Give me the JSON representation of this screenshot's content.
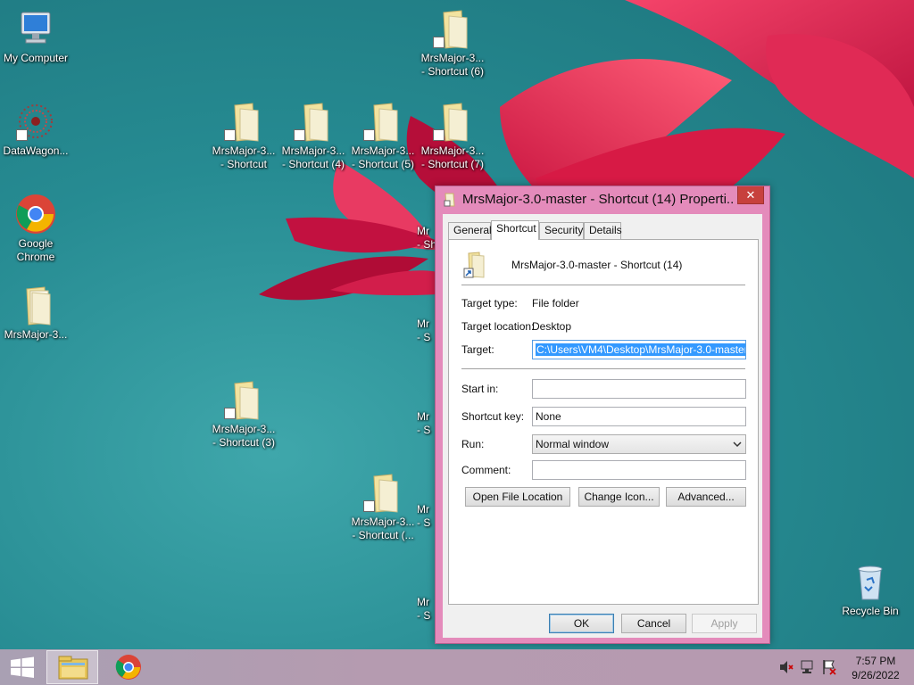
{
  "desktop_icons": [
    {
      "id": "my-computer",
      "label": "My Computer"
    },
    {
      "id": "datawagon",
      "label": "DataWagon..."
    },
    {
      "id": "google-chrome",
      "label": "Google\nChrome"
    },
    {
      "id": "mrsmajor",
      "label": "MrsMajor-3..."
    },
    {
      "id": "shortcut-6",
      "label": "MrsMajor-3...\n- Shortcut (6)"
    },
    {
      "id": "shortcut",
      "label": "MrsMajor-3...\n- Shortcut"
    },
    {
      "id": "shortcut-4",
      "label": "MrsMajor-3...\n- Shortcut (4)"
    },
    {
      "id": "shortcut-5",
      "label": "MrsMajor-3...\n- Shortcut (5)"
    },
    {
      "id": "shortcut-7",
      "label": "MrsMajor-3...\n- Shortcut (7)"
    },
    {
      "id": "shortcut-3",
      "label": "MrsMajor-3...\n- Shortcut (3)"
    },
    {
      "id": "shortcut-x",
      "label": "MrsMajor-3...\n- Shortcut (..."
    },
    {
      "id": "recycle-bin",
      "label": "Recycle Bin"
    },
    {
      "id": "partial-1",
      "label": "Mr\n- Sh"
    },
    {
      "id": "partial-2",
      "label": "Mr\n- S"
    },
    {
      "id": "partial-3",
      "label": "Mr\n- S"
    },
    {
      "id": "partial-4",
      "label": "Mr\n- S"
    },
    {
      "id": "partial-5",
      "label": "Mr\n- S"
    }
  ],
  "dialog": {
    "title": "MrsMajor-3.0-master - Shortcut (14) Properti...",
    "close_label": "✕",
    "tabs": [
      "General",
      "Shortcut",
      "Security",
      "Details"
    ],
    "active_tab": "Shortcut",
    "name": "MrsMajor-3.0-master - Shortcut (14)",
    "target_type_label": "Target type:",
    "target_type_value": "File folder",
    "target_location_label": "Target location:",
    "target_location_value": "Desktop",
    "target_label": "Target:",
    "target_value": "C:\\Users\\VM4\\Desktop\\MrsMajor-3.0-master",
    "start_in_label": "Start in:",
    "start_in_value": "",
    "shortcut_key_label": "Shortcut key:",
    "shortcut_key_value": "None",
    "run_label": "Run:",
    "run_value": "Normal window",
    "comment_label": "Comment:",
    "comment_value": "",
    "open_file_location": "Open File Location",
    "change_icon": "Change Icon...",
    "advanced": "Advanced...",
    "ok": "OK",
    "cancel": "Cancel",
    "apply": "Apply"
  },
  "taskbar": {
    "time": "7:57 PM",
    "date": "9/26/2022"
  },
  "colors": {
    "dialog_frame": "#e48bbb",
    "selection": "#3399ff",
    "desktop": "#268b92"
  }
}
